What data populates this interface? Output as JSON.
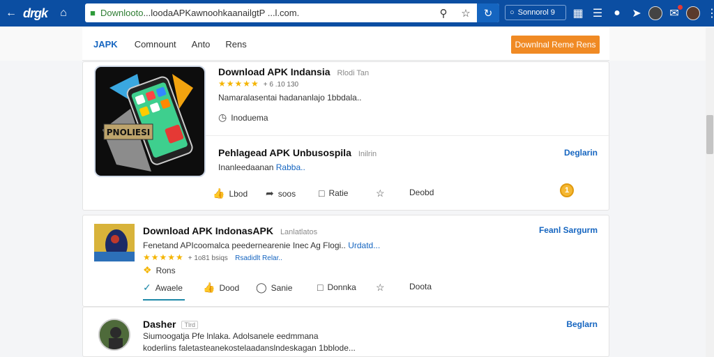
{
  "browser": {
    "brand": "drgk",
    "url_green": "Downlooto",
    "url_rest": "...loodaAPKawnoohkaanailgtP ...l.com.",
    "search_label": "Sonnorol 9"
  },
  "site_header": {
    "logo": "JAPK",
    "nav": [
      "Comnount",
      "Anto",
      "Rens"
    ],
    "cta": "Downlnal Reme Rens"
  },
  "card1": {
    "title": "Download APK Indansia",
    "title_meta": "Rlodi Tan",
    "rating_meta": "+ 6 .10 130",
    "description": "Namaralasentai hadananlajo 1bbdala..",
    "sub_label": "Inoduema",
    "section_title": "Pehlagead APK Unbusospila",
    "section_meta": "Inilrin",
    "section_link": "Deglarin",
    "section_desc_plain": "Inanleedaanan",
    "section_desc_link": "Rabba..",
    "icon_text": "PNOLIESI",
    "actions": [
      "Lbod",
      "soos",
      "Ratie",
      "",
      "Deobd"
    ],
    "coin_symbol": "1"
  },
  "card2": {
    "title": "Download APK IndonasAPK",
    "title_meta": "Lanlatlatos",
    "link_right": "Feanl Sargurm",
    "description": "Fenetand APIcoomalca peedernearenie Inec Ag Flogi..",
    "description_link": "Urdatd...",
    "rating_meta": "+ 1o81 bsiqs",
    "rating_link": "Rsadidlt Relar..",
    "badge": "Rons",
    "actions": [
      "Awaele",
      "Dood",
      "Sanie",
      "Donnka",
      "",
      "Doota"
    ]
  },
  "card3": {
    "title": "Dasher",
    "tag": "Tlrd",
    "link_right": "Beglarn",
    "line1": "Siumoogatja Pfe lnlaka. Adolsanele eedmmana",
    "line2": "koderlins faletasteanekostelaadanslndeskagan 1bblode..."
  },
  "colors": {
    "topbar": "#0b4ea2",
    "accent": "#1565c0",
    "cta": "#f08a24",
    "star": "#f4b400"
  }
}
